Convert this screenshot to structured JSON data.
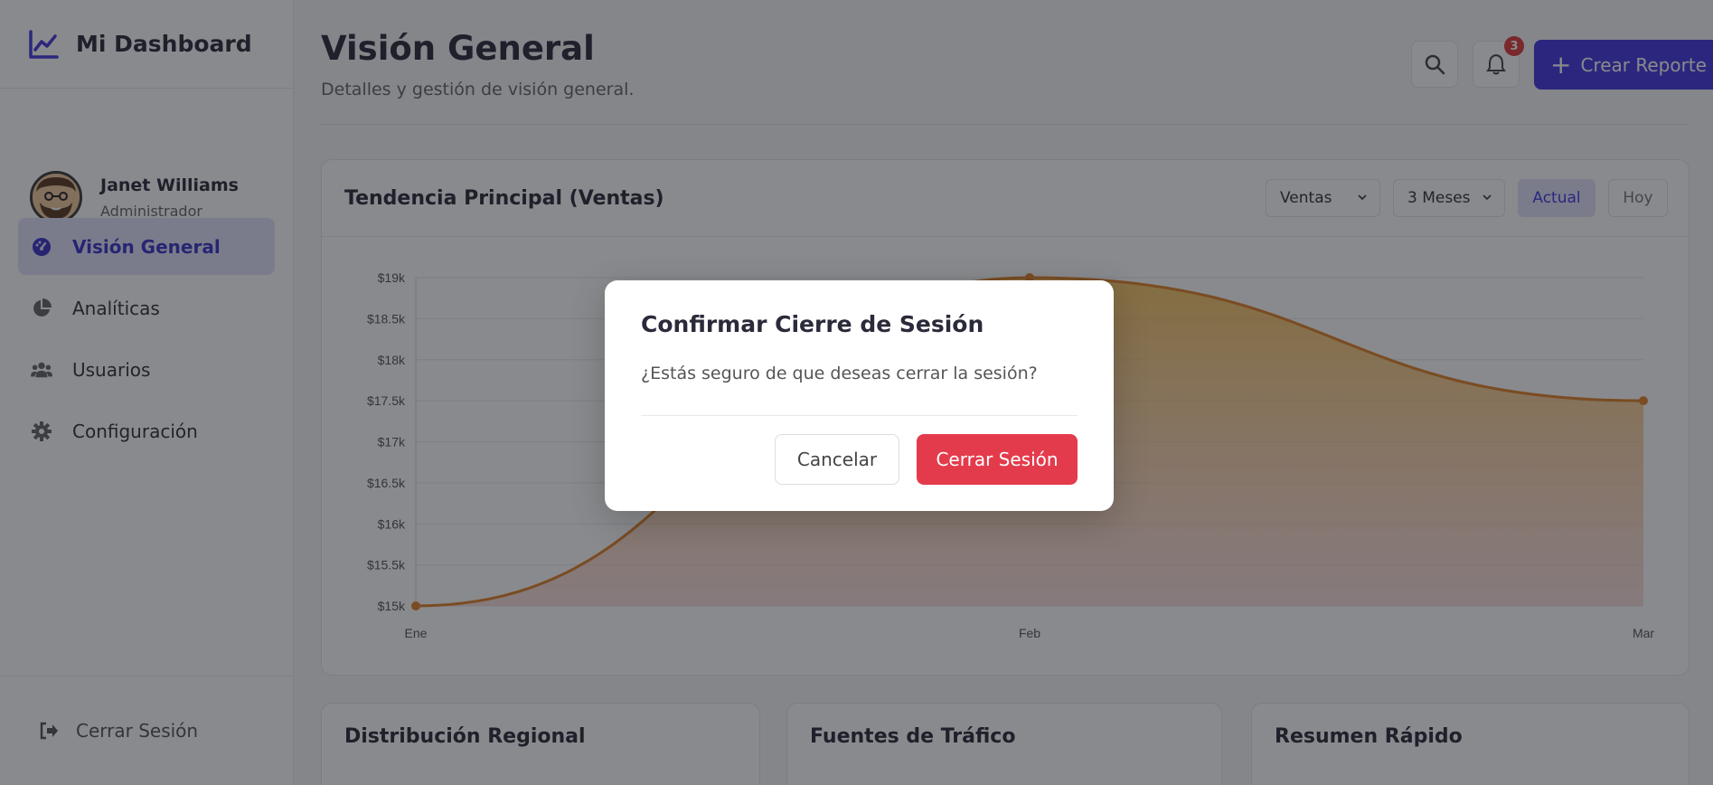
{
  "app": {
    "brand_title": "Mi Dashboard"
  },
  "user": {
    "name": "Janet Williams",
    "role": "Administrador"
  },
  "sidebar": {
    "items": [
      {
        "label": "Visión General",
        "icon": "gauge-icon",
        "active": true
      },
      {
        "label": "Analíticas",
        "icon": "pie-chart-icon",
        "active": false
      },
      {
        "label": "Usuarios",
        "icon": "users-icon",
        "active": false
      },
      {
        "label": "Configuración",
        "icon": "gear-icon",
        "active": false
      }
    ],
    "logout_label": "Cerrar Sesión"
  },
  "header": {
    "title": "Visión General",
    "subtitle": "Detalles y gestión de visión general.",
    "notification_count": "3",
    "create_label": "Crear Reporte"
  },
  "chart_card": {
    "title": "Tendencia Principal (Ventas)",
    "metric_select": "Ventas",
    "range_select": "3 Meses",
    "actual_label": "Actual",
    "hoy_label": "Hoy"
  },
  "chart_data": {
    "type": "area",
    "title": "Tendencia Principal (Ventas)",
    "categories": [
      "Ene",
      "Feb",
      "Mar"
    ],
    "series": [
      {
        "values": [
          15000,
          19000,
          17500
        ]
      }
    ],
    "ylim": [
      15000,
      19000
    ],
    "yticks": [
      "$15k",
      "$15.5k",
      "$16k",
      "$16.5k",
      "$17k",
      "$17.5k",
      "$18k",
      "$18.5k",
      "$19k"
    ],
    "grid": true,
    "colors": {
      "line": "#e0822b",
      "fill_top": "#f2b233",
      "fill_bottom": "#f5c4c4"
    }
  },
  "cards": [
    {
      "title": "Distribución Regional"
    },
    {
      "title": "Fuentes de Tráfico"
    },
    {
      "title": "Resumen Rápido"
    }
  ],
  "modal": {
    "title": "Confirmar Cierre de Sesión",
    "message": "¿Estás seguro de que deseas cerrar la sesión?",
    "cancel_label": "Cancelar",
    "confirm_label": "Cerrar Sesión"
  },
  "colors": {
    "accent": "#4338e0",
    "danger": "#e43b4c"
  }
}
